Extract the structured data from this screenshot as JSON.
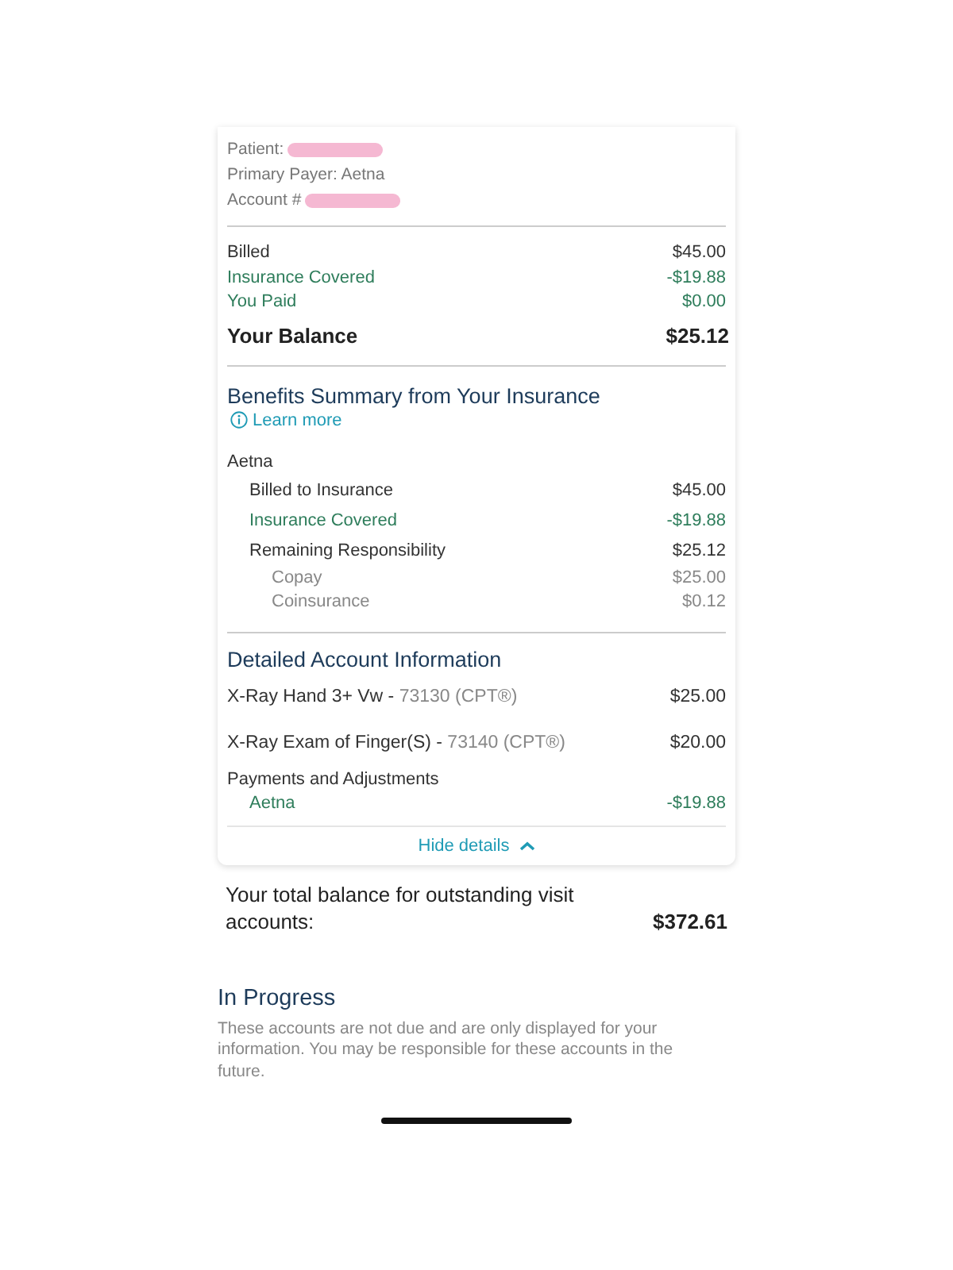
{
  "patient_info": [
    {
      "label": "Patient:",
      "redacted": true
    },
    {
      "label": "Primary Payer: Aetna",
      "redacted": false
    },
    {
      "label": "Account #",
      "redacted": true
    }
  ],
  "summary": [
    {
      "label": "Billed",
      "amount": "$45.00",
      "kind": "plain"
    },
    {
      "label": "Insurance Covered",
      "amount": "-$19.88",
      "kind": "credit"
    },
    {
      "label": "You Paid",
      "amount": "$0.00",
      "kind": "credit"
    },
    {
      "label": "Your Balance",
      "amount": "$25.12",
      "kind": "total"
    }
  ],
  "benefits": {
    "title": "Benefits Summary from Your Insurance",
    "link": "Learn more",
    "payer": "Aetna",
    "rows": [
      {
        "label": "Billed to Insurance",
        "amount": "$45.00",
        "kind": "plain"
      },
      {
        "label": "Insurance Covered",
        "amount": "-$19.88",
        "kind": "credit"
      },
      {
        "label": "Remaining Responsibility",
        "amount": "$25.12",
        "kind": "plain",
        "children": [
          {
            "label": "Copay",
            "amount": "$25.00",
            "kind": "muted"
          },
          {
            "label": "Coinsurance",
            "amount": "$0.12",
            "kind": "muted"
          }
        ]
      }
    ]
  },
  "details": {
    "title": "Detailed Account Information",
    "items": [
      {
        "name": "X-Ray Hand 3+ Vw - ",
        "code": "73130 (CPT®)",
        "amount": "$25.00"
      },
      {
        "name": "X-Ray Exam of Finger(S) - ",
        "code": "73140 (CPT®)",
        "amount": "$20.00"
      }
    ],
    "payments_title": "Payments and Adjustments",
    "payments": [
      {
        "label": "Aetna",
        "amount": "-$19.88",
        "kind": "credit"
      }
    ]
  },
  "toggle": {
    "label": "Hide details",
    "expanded": true
  },
  "total": {
    "label": "Your total balance for outstanding visit accounts:",
    "amount": "$372.61"
  },
  "in_progress": {
    "title": "In Progress",
    "text": "These accounts are not due and are only displayed for your information. You may be responsible for these accounts in the future."
  }
}
